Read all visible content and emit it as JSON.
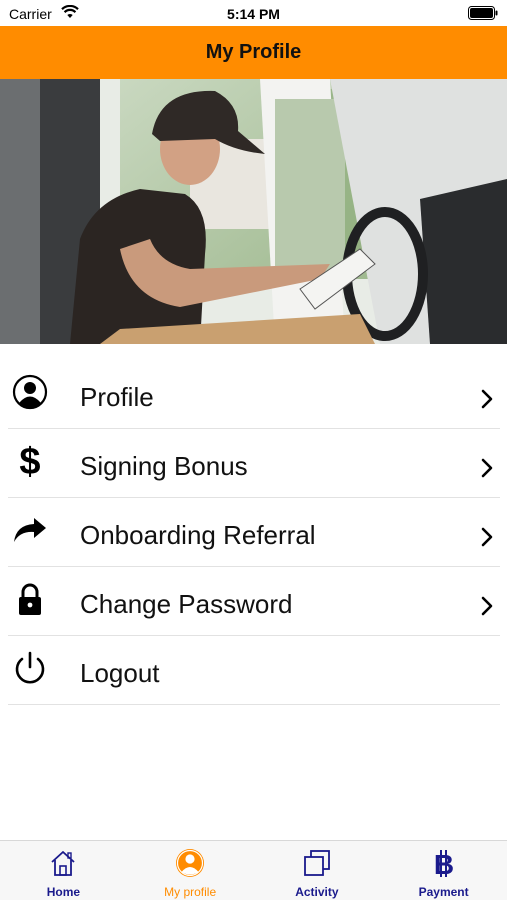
{
  "status_bar": {
    "carrier": "Carrier",
    "time": "5:14 PM"
  },
  "nav": {
    "title": "My Profile"
  },
  "hero": {
    "icon": "delivery-driver-photo"
  },
  "menu": {
    "items": [
      {
        "label": "Profile",
        "icon": "user-circle-icon",
        "has_chevron": true
      },
      {
        "label": "Signing Bonus",
        "icon": "dollar-icon",
        "has_chevron": true
      },
      {
        "label": "Onboarding Referral",
        "icon": "share-arrow-icon",
        "has_chevron": true
      },
      {
        "label": "Change Password",
        "icon": "lock-icon",
        "has_chevron": true
      },
      {
        "label": "Logout",
        "icon": "power-icon",
        "has_chevron": false
      }
    ]
  },
  "tabs": {
    "items": [
      {
        "label": "Home",
        "icon": "home-icon",
        "active": false
      },
      {
        "label": "My profile",
        "icon": "profile-icon",
        "active": true
      },
      {
        "label": "Activity",
        "icon": "activity-icon",
        "active": false
      },
      {
        "label": "Payment",
        "icon": "bitcoin-icon",
        "active": false
      }
    ]
  },
  "colors": {
    "accent": "#ff8c00",
    "tab_inactive": "#1a1a8c"
  }
}
